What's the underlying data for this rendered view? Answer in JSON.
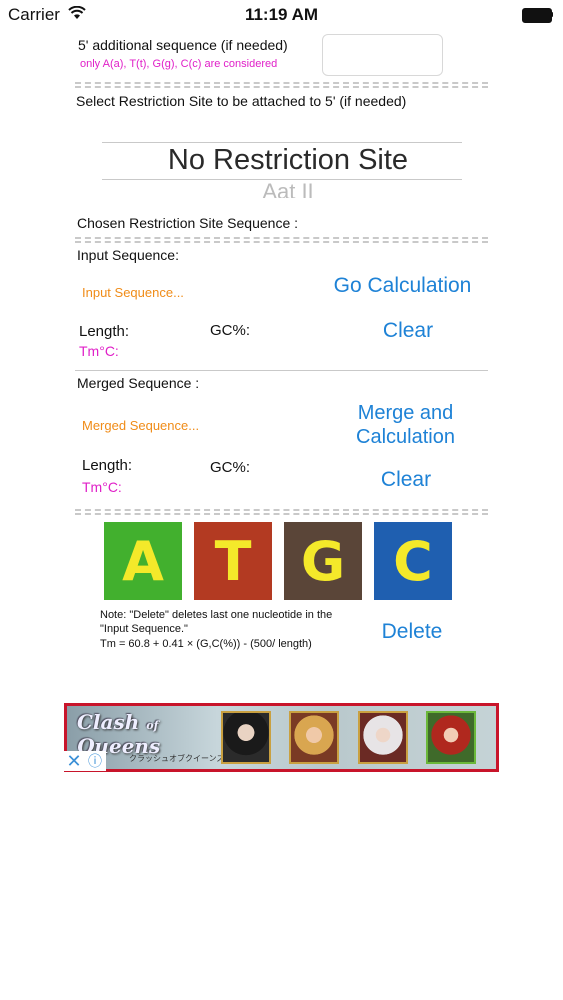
{
  "status": {
    "carrier": "Carrier",
    "time": "11:19 AM"
  },
  "five_prime": {
    "label": "5' additional sequence (if needed)",
    "note": "only A(a), T(t), G(g), C(c) are considered",
    "value": ""
  },
  "restriction": {
    "label": "Select Restriction Site to be attached to 5' (if needed)",
    "selected": "No Restriction Site",
    "next": "Aat II",
    "chosen_label": "Chosen Restriction Site Sequence :"
  },
  "input": {
    "label": "Input Sequence:",
    "placeholder": "Input Sequence...",
    "go_button": "Go Calculation",
    "length_label": "Length:",
    "gc_label": "GC%:",
    "tm_label": "Tm°C:",
    "clear_button": "Clear"
  },
  "merged": {
    "label": "Merged Sequence :",
    "placeholder": "Merged Sequence...",
    "merge_button_line1": "Merge and",
    "merge_button_line2": "Calculation",
    "length_label": "Length:",
    "gc_label": "GC%:",
    "tm_label": "Tm°C:",
    "clear_button": "Clear"
  },
  "bases": [
    {
      "letter": "A",
      "color": "#42b02e"
    },
    {
      "letter": "T",
      "color": "#b33a22"
    },
    {
      "letter": "G",
      "color": "#5a4538"
    },
    {
      "letter": "C",
      "color": "#1f5fb0"
    }
  ],
  "note": {
    "line1": "Note: \"Delete\" deletes last one nucleotide in the",
    "line2": "\"Input Sequence.\"",
    "formula": "Tm = 60.8 + 0.41 × (G,C(%)) - (500/ length)",
    "delete_button": "Delete"
  },
  "ad": {
    "logo_line1": "Clash",
    "logo_line2": "of",
    "logo_line3": "Queens",
    "subtitle": "クラッシュオブクイーンズ",
    "close_icon": "✕",
    "info_icon": "ⓘ"
  }
}
